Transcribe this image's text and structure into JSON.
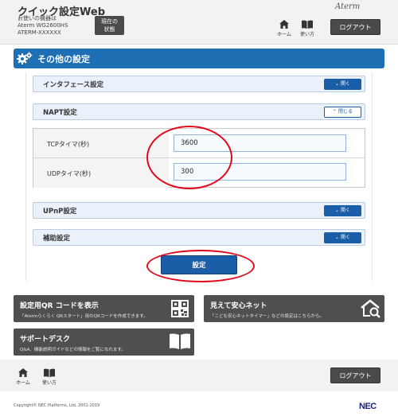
{
  "header": {
    "app_title": "クイック設定Web",
    "device_line1": "お使いの機器は",
    "device_line2": "Aterm WG2600HS",
    "device_line3": "ATERM-XXXXXX",
    "status_btn_line1": "現在の",
    "status_btn_line2": "状態",
    "brand": "Aterm",
    "home_label": "ホーム",
    "help_label": "使い方",
    "logout_label": "ログアウト"
  },
  "page": {
    "title": "その他の設定"
  },
  "sections": {
    "interface": {
      "title": "インタフェース設定",
      "toggle": "開く"
    },
    "napt": {
      "title": "NAPT設定",
      "toggle": "閉じる"
    },
    "upnp": {
      "title": "UPnP設定",
      "toggle": "開く"
    },
    "aux": {
      "title": "補助設定",
      "toggle": "開く"
    }
  },
  "napt": {
    "tcp_label": "TCPタイマ(秒)",
    "tcp_value": "3600",
    "udp_label": "UDPタイマ(秒)",
    "udp_value": "300"
  },
  "actions": {
    "apply_label": "設定"
  },
  "tiles": {
    "qr": {
      "title": "設定用QR コードを表示",
      "subtitle": "「Atermらくらく QRスタート」用のQRコードを作成できます。"
    },
    "safe": {
      "title": "見えて安心ネット",
      "subtitle": "「こども安心ネットタイマー」などの設定はこちらから。"
    },
    "support": {
      "title": "サポートデスク",
      "subtitle": "Q&A、機能説明ガイドなどの情報をご覧になれます。"
    }
  },
  "footer": {
    "home_label": "ホーム",
    "help_label": "使い方",
    "logout_label": "ログアウト",
    "copyright": "Copyright© NEC Platforms, Ltd. 2001-2019",
    "nec": "NEC"
  },
  "colors": {
    "accent_blue": "#1f6fb5",
    "dark_button": "#4a4a4a",
    "highlight_red": "#e2081b"
  }
}
